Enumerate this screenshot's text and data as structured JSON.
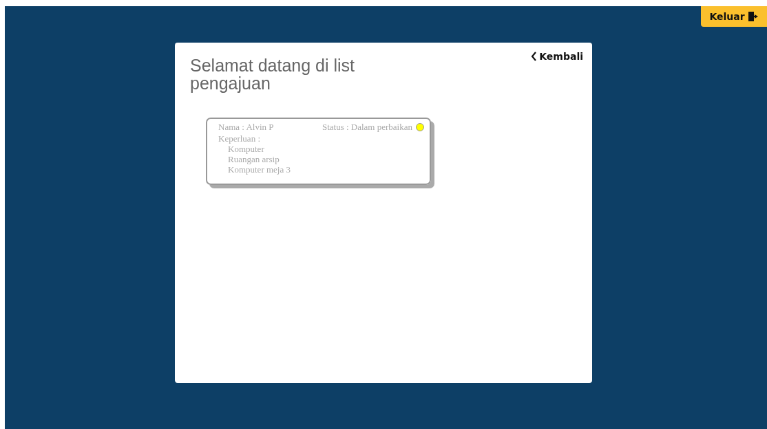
{
  "logout_button": {
    "label": "Keluar"
  },
  "panel": {
    "back_link": "Kembali",
    "title": "Selamat datang di list pengajuan",
    "requests": [
      {
        "name": "Nama : Alvin P",
        "status": "Status : Dalam perbaikan",
        "color": "#ffff00",
        "purpose_label": "Keperluan :",
        "purpose_items": [
          "Komputer",
          "Ruangan arsip",
          "Komputer meja 3"
        ]
      }
    ]
  }
}
